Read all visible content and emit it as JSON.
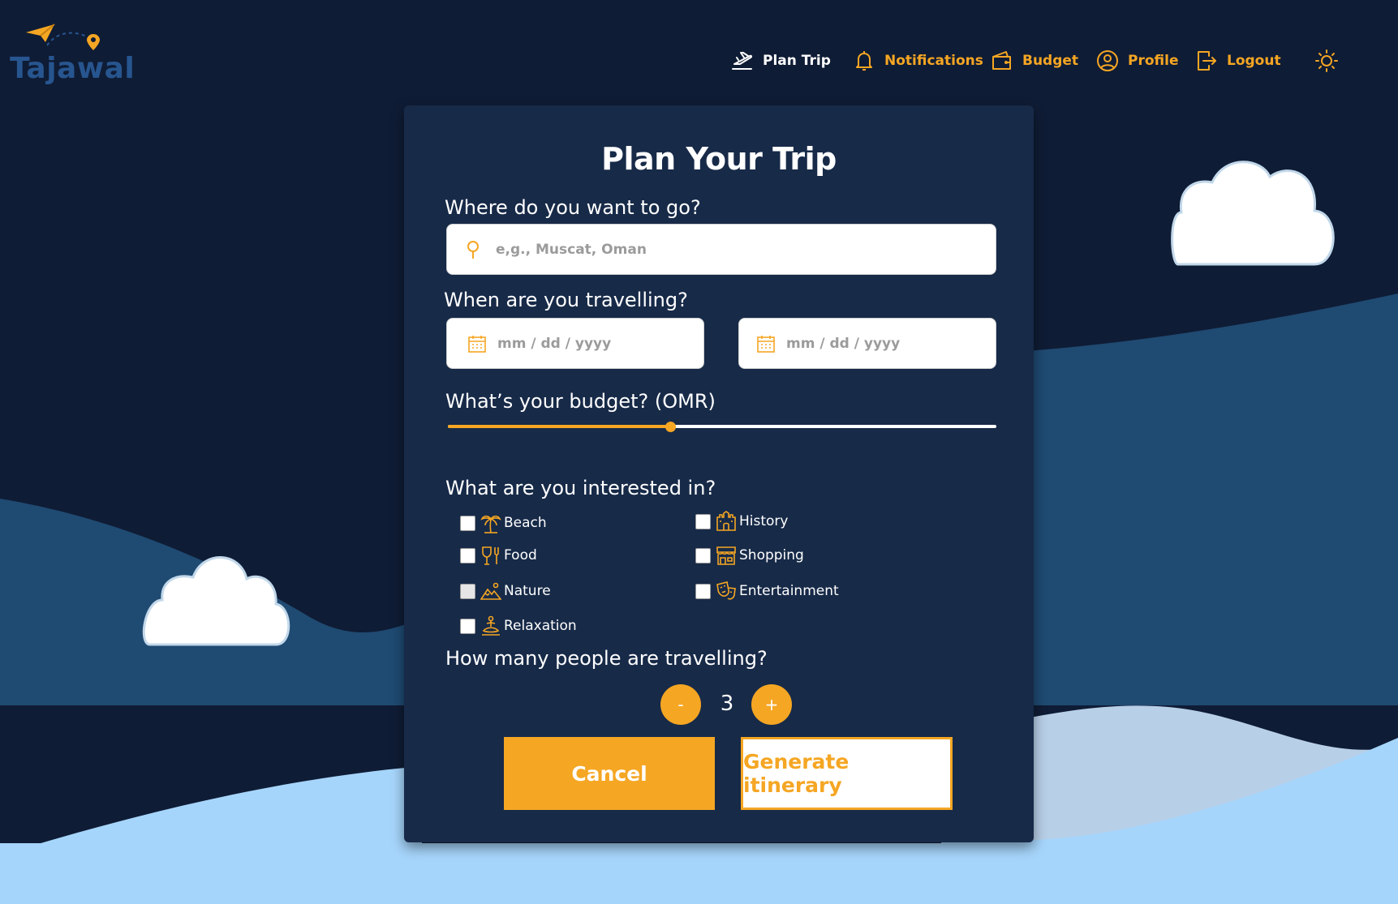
{
  "brand": {
    "name": "Tajawal"
  },
  "nav": {
    "plan_trip": "Plan Trip",
    "notifications": "Notifications",
    "budget": "Budget",
    "profile": "Profile",
    "logout": "Logout"
  },
  "form": {
    "title": "Plan Your Trip",
    "destination": {
      "label": "Where do you want to go?",
      "placeholder": "e,g., Muscat, Oman",
      "icon": "map-pin-icon"
    },
    "dates": {
      "label": "When are you travelling?",
      "start_placeholder": "mm / dd / yyyy",
      "end_placeholder": "mm / dd / yyyy",
      "icon": "calendar-icon"
    },
    "budget": {
      "label": "What’s your budget? (OMR)",
      "level": 0.405
    },
    "interests": {
      "label": "What are you interested in?",
      "items": [
        {
          "label": "Beach",
          "icon": "palm-tree-icon",
          "checked": false
        },
        {
          "label": "History",
          "icon": "castle-icon",
          "checked": false
        },
        {
          "label": "Food",
          "icon": "food-icon",
          "checked": false
        },
        {
          "label": "Shopping",
          "icon": "store-icon",
          "checked": false
        },
        {
          "label": "Nature",
          "icon": "mountain-icon",
          "checked": false
        },
        {
          "label": "Entertainment",
          "icon": "theater-masks-icon",
          "checked": false
        },
        {
          "label": "Relaxation",
          "icon": "meditation-icon",
          "checked": false
        }
      ]
    },
    "travellers": {
      "label": "How many people are travelling?",
      "minus": "-",
      "plus": "+",
      "count": "3"
    },
    "cancel_label": "Cancel",
    "generate_label": "Generate itinerary"
  },
  "colors": {
    "accent": "#f5a623",
    "navy": "#0f1c35",
    "card": "#172a48",
    "hill": "#1f4a72",
    "light": "#a6d5fb"
  }
}
